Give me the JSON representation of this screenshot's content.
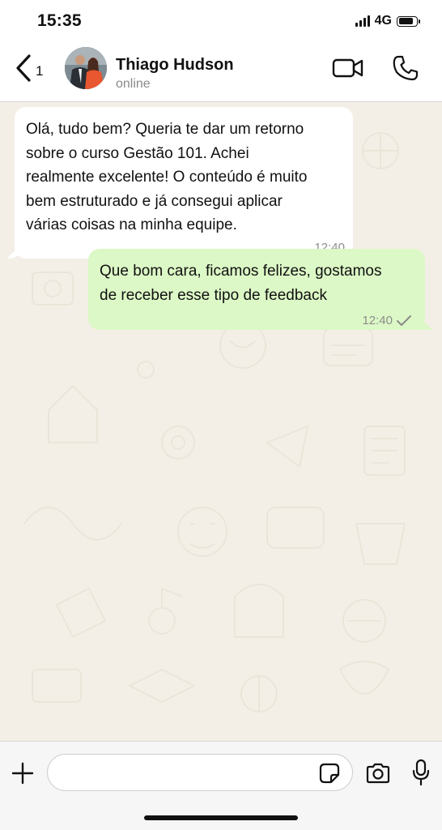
{
  "status_bar": {
    "time": "15:35",
    "network": "4G",
    "battery_level": 0.85
  },
  "header": {
    "back_count": "1",
    "contact_name": "Thiago  Hudson",
    "contact_status": "online",
    "icons": [
      "chevron-left-icon",
      "video-camera-icon",
      "phone-icon"
    ]
  },
  "messages": [
    {
      "direction": "incoming",
      "lines": [
        "Olá,  tudo bem?  Queria te dar um retorno",
        "sobre o curso Gestão 101. Achei",
        "realmente excelente! O conteúdo é muito",
        "bem estruturado e já consegui aplicar",
        "várias coisas na minha equipe."
      ],
      "time": "12:40"
    },
    {
      "direction": "outgoing",
      "lines": [
        "Que bom cara,  ficamos felizes,  gostamos",
        "de receber esse  tipo de feedback"
      ],
      "time": "12:40",
      "status": "sent"
    }
  ],
  "input_bar": {
    "placeholder": "",
    "value": "",
    "icons": [
      "plus-icon",
      "sticker-icon",
      "camera-icon",
      "microphone-icon"
    ]
  },
  "colors": {
    "incoming_bubble": "#ffffff",
    "outgoing_bubble": "#dcf8c6",
    "chat_background": "#f4efe6",
    "tick": "#8c8c8c"
  }
}
